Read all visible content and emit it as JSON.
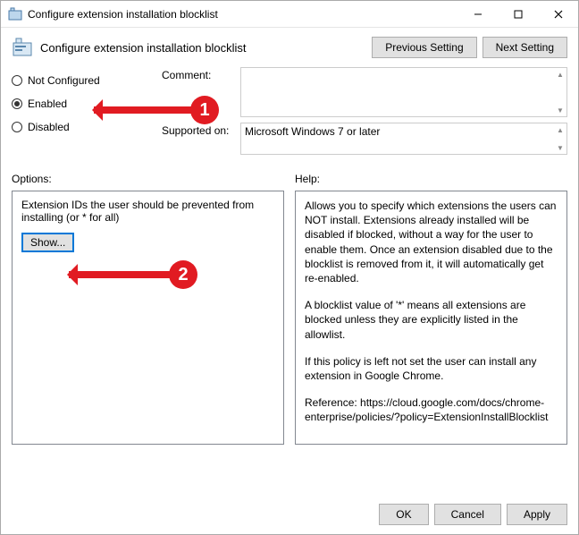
{
  "window": {
    "title": "Configure extension installation blocklist"
  },
  "header": {
    "title": "Configure extension installation blocklist",
    "prev_label": "Previous Setting",
    "next_label": "Next Setting"
  },
  "radios": {
    "not_configured": "Not Configured",
    "enabled": "Enabled",
    "disabled": "Disabled",
    "selected": "enabled"
  },
  "fields": {
    "comment_label": "Comment:",
    "comment_value": "",
    "supported_label": "Supported on:",
    "supported_value": "Microsoft Windows 7 or later"
  },
  "options": {
    "label": "Options:",
    "text": "Extension IDs the user should be prevented from installing (or * for all)",
    "show_label": "Show..."
  },
  "help": {
    "label": "Help:",
    "p1": "Allows you to specify which extensions the users can NOT install. Extensions already installed will be disabled if blocked, without a way for the user to enable them. Once an extension disabled due to the blocklist is removed from it, it will automatically get re-enabled.",
    "p2": "A blocklist value of '*' means all extensions are blocked unless they are explicitly listed in the allowlist.",
    "p3": "If this policy is left not set the user can install any extension in Google Chrome.",
    "p4": "Reference: https://cloud.google.com/docs/chrome-enterprise/policies/?policy=ExtensionInstallBlocklist"
  },
  "footer": {
    "ok": "OK",
    "cancel": "Cancel",
    "apply": "Apply"
  },
  "annotations": {
    "one": "1",
    "two": "2"
  }
}
